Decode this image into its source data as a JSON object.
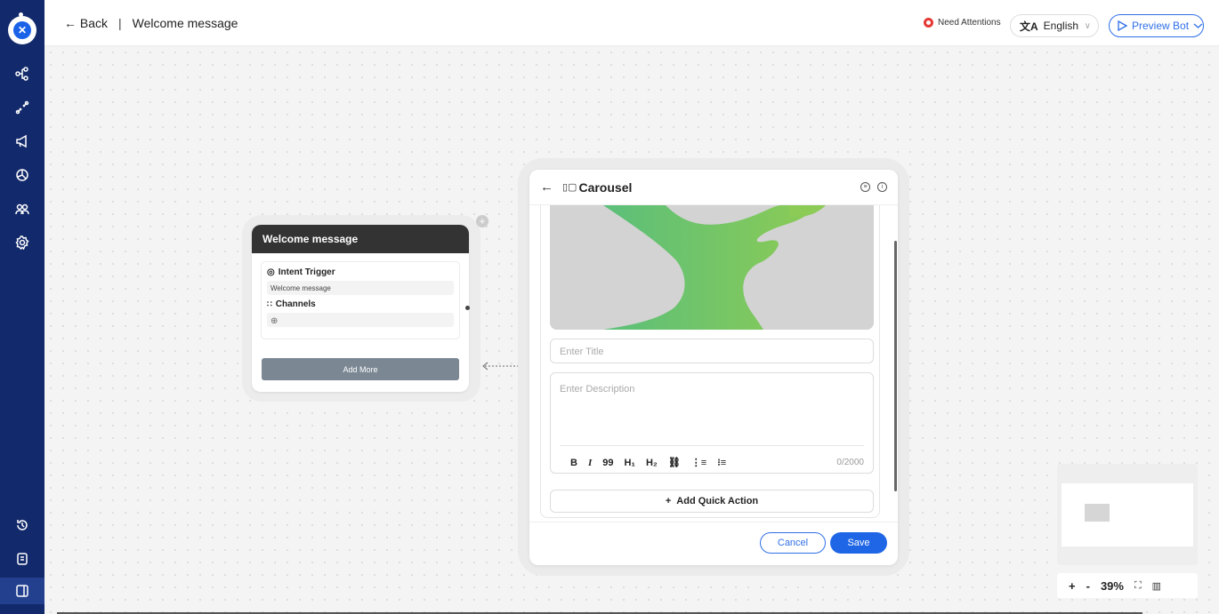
{
  "sidebar": {
    "logo_icon": "bot-logo-icon",
    "items": [
      {
        "icon": "flow-icon"
      },
      {
        "icon": "integrations-icon"
      },
      {
        "icon": "broadcast-icon"
      },
      {
        "icon": "analytics-icon"
      },
      {
        "icon": "users-icon"
      },
      {
        "icon": "settings-icon"
      }
    ],
    "bottom_items": [
      {
        "icon": "history-icon"
      },
      {
        "icon": "docs-icon"
      },
      {
        "icon": "collapse-panel-icon"
      }
    ]
  },
  "header": {
    "back_label": "← Back",
    "separator": "|",
    "page_title": "Welcome message",
    "need_attentions": "Need Attentions",
    "language": "English",
    "preview_bot": "Preview Bot",
    "accent_color": "#2f6fe8",
    "alert_color": "#e53935"
  },
  "node": {
    "title": "Welcome message",
    "intent_label": "Intent Trigger",
    "intent_value": "Welcome message",
    "channels_label": "Channels",
    "add_more": "Add More",
    "plus": "+"
  },
  "panel": {
    "title": "Carousel",
    "title_placeholder": "Enter Title",
    "description_placeholder": "Enter Description",
    "toolbar": [
      "B",
      "I",
      "99",
      "H1",
      "H2",
      "link",
      "ordered-list",
      "bullet-list"
    ],
    "char_count": "0/2000",
    "add_quick_action": "Add Quick Action",
    "cancel": "Cancel",
    "save": "Save"
  },
  "zoom": {
    "plus": "+",
    "minus": "-",
    "level": "39%"
  }
}
